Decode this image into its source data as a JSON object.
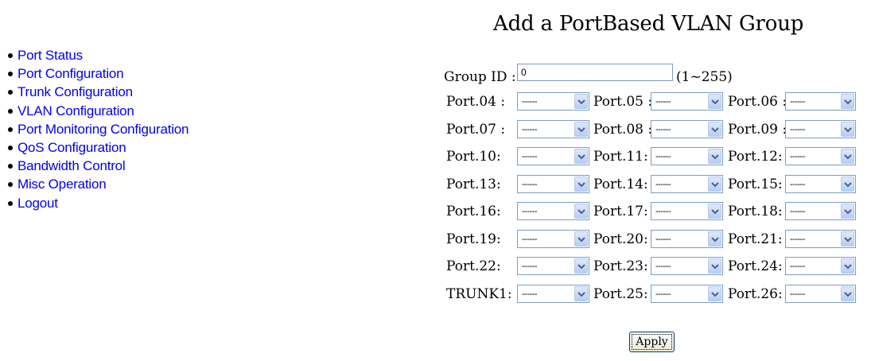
{
  "sidebar": {
    "items": [
      {
        "label": "Port Status",
        "name": "nav-port-status"
      },
      {
        "label": "Port Configuration",
        "name": "nav-port-configuration"
      },
      {
        "label": "Trunk Configuration",
        "name": "nav-trunk-configuration"
      },
      {
        "label": "VLAN Configuration",
        "name": "nav-vlan-configuration"
      },
      {
        "label": "Port Monitoring Configuration",
        "name": "nav-port-monitoring-configuration"
      },
      {
        "label": "QoS Configuration",
        "name": "nav-qos-configuration"
      },
      {
        "label": "Bandwidth Control",
        "name": "nav-bandwidth-control"
      },
      {
        "label": "Misc Operation",
        "name": "nav-misc-operation"
      },
      {
        "label": "Logout",
        "name": "nav-logout"
      }
    ]
  },
  "page": {
    "title": "Add a PortBased VLAN Group"
  },
  "group": {
    "label": "Group ID :",
    "value": "0",
    "range": "(1~255)"
  },
  "ports": {
    "rows": [
      [
        {
          "label": "Port.04 :",
          "value": "------"
        },
        {
          "label": "Port.05 :",
          "value": "------"
        },
        {
          "label": "Port.06 :",
          "value": "------"
        }
      ],
      [
        {
          "label": "Port.07 :",
          "value": "------"
        },
        {
          "label": "Port.08 :",
          "value": "------"
        },
        {
          "label": "Port.09 :",
          "value": "------"
        }
      ],
      [
        {
          "label": "Port.10:",
          "value": "------"
        },
        {
          "label": "Port.11:",
          "value": "------"
        },
        {
          "label": "Port.12:",
          "value": "------"
        }
      ],
      [
        {
          "label": "Port.13:",
          "value": "------"
        },
        {
          "label": "Port.14:",
          "value": "------"
        },
        {
          "label": "Port.15:",
          "value": "------"
        }
      ],
      [
        {
          "label": "Port.16:",
          "value": "------"
        },
        {
          "label": "Port.17:",
          "value": "------"
        },
        {
          "label": "Port.18:",
          "value": "------"
        }
      ],
      [
        {
          "label": "Port.19:",
          "value": "------"
        },
        {
          "label": "Port.20:",
          "value": "------"
        },
        {
          "label": "Port.21:",
          "value": "------"
        }
      ],
      [
        {
          "label": "Port.22:",
          "value": "------"
        },
        {
          "label": "Port.23:",
          "value": "------"
        },
        {
          "label": "Port.24:",
          "value": "------"
        }
      ],
      [
        {
          "label": "TRUNK1:",
          "value": "------"
        },
        {
          "label": "Port.25:",
          "value": "------"
        },
        {
          "label": "Port.26:",
          "value": "------"
        }
      ]
    ]
  },
  "actions": {
    "apply_label": "Apply"
  },
  "icons": {
    "dropdown": "chevron-down-icon",
    "bullet": "bullet-icon"
  },
  "colors": {
    "link": "#0000ee",
    "dropdown_arrow": "#4d6185",
    "field_border": "#7f9db9"
  }
}
